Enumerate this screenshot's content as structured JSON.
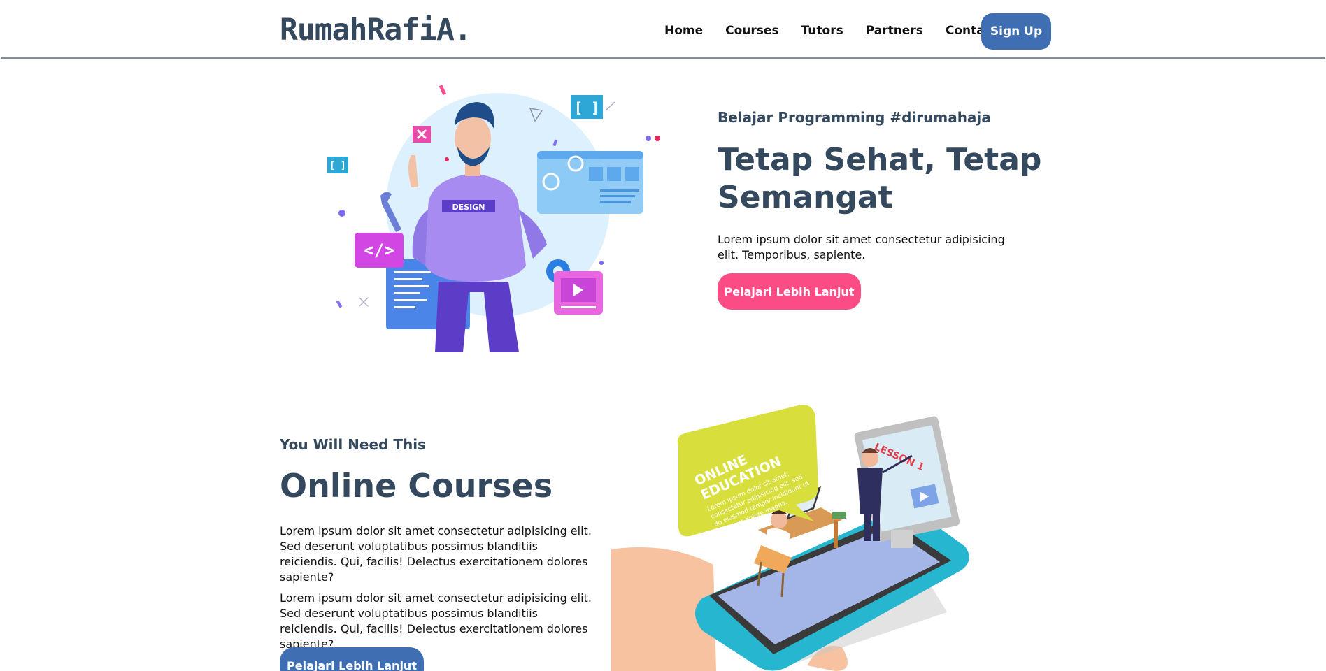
{
  "nav": {
    "logo": "RumahRafiA.",
    "links": [
      "Home",
      "Courses",
      "Tutors",
      "Partners",
      "Contact"
    ],
    "signup_label": "Sign Up"
  },
  "hero": {
    "subtitle": "Belajar Programming #dirumahaja",
    "title": "Tetap Sehat, Tetap Semangat",
    "text": "Lorem ipsum dolor sit amet consectetur adipisicing elit. Temporibus, sapiente.",
    "button_label": "Pelajari Lebih Lanjut",
    "illustration": {
      "badge_text": "DESIGN",
      "bracket_text": "[ ]",
      "code_text": "</>"
    }
  },
  "courses": {
    "subtitle": "You Will Need This",
    "title": "Online Courses",
    "paragraph1": "Lorem ipsum dolor sit amet consectetur adipisicing elit. Sed deserunt voluptatibus possimus blanditiis reiciendis. Qui, facilis! Delectus exercitationem dolores sapiente?",
    "paragraph2": "Lorem ipsum dolor sit amet consectetur adipisicing elit. Sed deserunt voluptatibus possimus blanditiis reiciendis. Qui, facilis! Delectus exercitationem dolores sapiente?",
    "button_label": "Pelajari Lebih Lanjut",
    "illustration": {
      "bubble_line1": "ONLINE",
      "bubble_line2": "EDUCATION",
      "bubble_small1": "Lorem ipsum dolor sit amet,",
      "bubble_small2": "consectetur adipisicing elit, sed",
      "bubble_small3": "do eiusmod tempor incididunt ut",
      "bubble_small4": "labore et dolore magna.",
      "lesson_text": "LESSON 1"
    }
  },
  "colors": {
    "primary": "#3f6fb2",
    "accent": "#fc4c86",
    "heading": "#34495e",
    "navbar_border": "#7d8ea5"
  }
}
